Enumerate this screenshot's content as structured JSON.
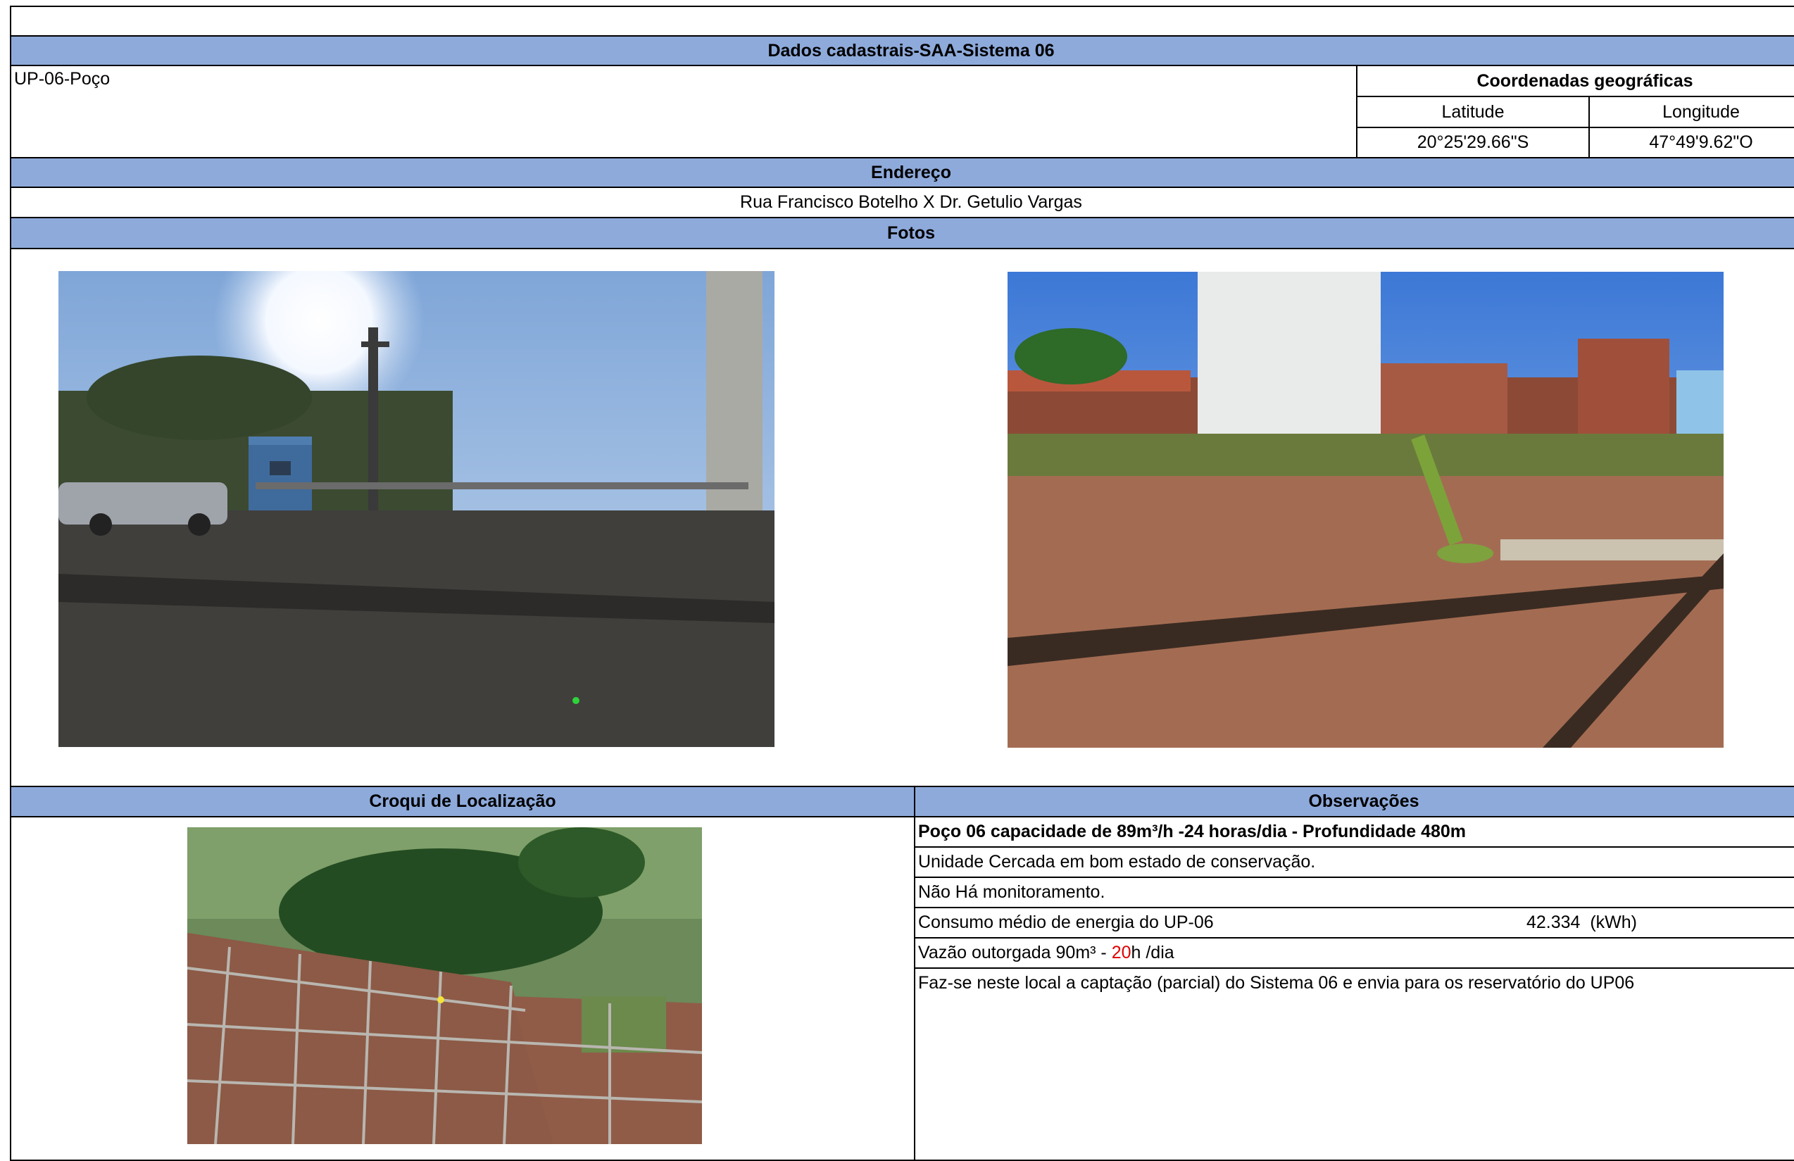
{
  "header": {
    "title": "Dados cadastrais-SAA-Sistema 06"
  },
  "unit": {
    "name": "UP-06-Poço"
  },
  "coordinates": {
    "title": "Coordenadas geográficas",
    "latitude_label": "Latitude",
    "longitude_label": "Longitude",
    "latitude_value": "20°25'29.66\"S",
    "longitude_value": "47°49'9.62\"O"
  },
  "address": {
    "label": "Endereço",
    "value": "Rua Francisco Botelho X Dr. Getulio Vargas"
  },
  "photos": {
    "label": "Fotos"
  },
  "sketch": {
    "label": "Croqui de Localização"
  },
  "observations": {
    "label": "Observações",
    "line1": "Poço 06 capacidade de 89m³/h -24 horas/dia - Profundidade 480m",
    "line2": "Unidade Cercada em bom estado de conservação.",
    "line3": "Não Há monitoramento.",
    "line4_label": "Consumo médio de energia do UP-06",
    "line4_value": "42.334  (kWh)",
    "line5_pre": "Vazão outorgada 90m³ - ",
    "line5_hours": "20",
    "line5_post": "h /dia",
    "line6": "Faz-se neste local a captação (parcial) do Sistema 06 e envia para os reservatório do  UP06"
  },
  "colors": {
    "header_bg": "#8eaadb",
    "accent_red": "#e00000"
  }
}
